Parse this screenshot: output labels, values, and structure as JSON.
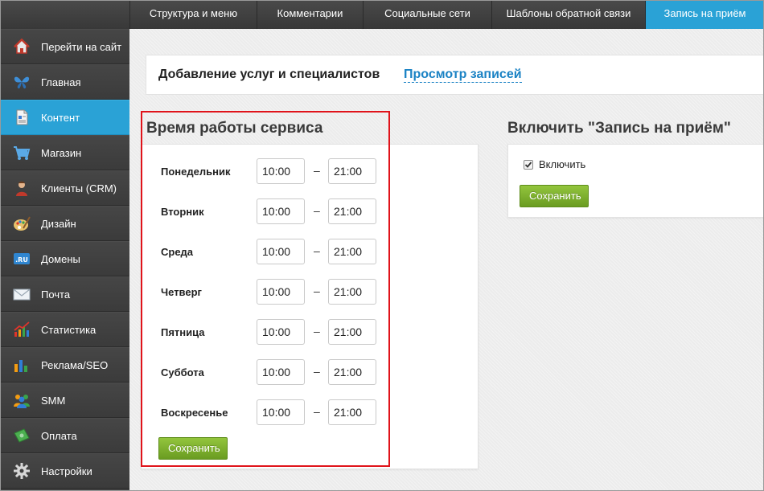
{
  "topbar": {
    "tabs": [
      {
        "label": "Структура и меню",
        "active": false
      },
      {
        "label": "Комментарии",
        "active": false
      },
      {
        "label": "Социальные сети",
        "active": false
      },
      {
        "label": "Шаблоны обратной связи",
        "active": false
      },
      {
        "label": "Запись на приём",
        "active": true
      }
    ]
  },
  "sidebar": {
    "items": [
      {
        "label": "Перейти на сайт",
        "icon": "home-icon"
      },
      {
        "label": "Главная",
        "icon": "butterfly-icon"
      },
      {
        "label": "Контент",
        "icon": "document-icon",
        "active": true
      },
      {
        "label": "Магазин",
        "icon": "cart-icon"
      },
      {
        "label": "Клиенты (CRM)",
        "icon": "user-icon"
      },
      {
        "label": "Дизайн",
        "icon": "palette-icon"
      },
      {
        "label": "Домены",
        "icon": "domain-ru-icon",
        "badge": ".RU"
      },
      {
        "label": "Почта",
        "icon": "mail-icon"
      },
      {
        "label": "Статистика",
        "icon": "chart-up-icon"
      },
      {
        "label": "Реклама/SEO",
        "icon": "bar-chart-icon"
      },
      {
        "label": "SMM",
        "icon": "people-icon"
      },
      {
        "label": "Оплата",
        "icon": "money-icon"
      },
      {
        "label": "Настройки",
        "icon": "gear-icon"
      }
    ]
  },
  "header": {
    "title": "Добавление услуг и специалистов",
    "link": "Просмотр записей"
  },
  "schedule": {
    "title": "Время работы сервиса",
    "separator": "–",
    "days": [
      {
        "day": "Понедельник",
        "from": "10:00",
        "to": "21:00"
      },
      {
        "day": "Вторник",
        "from": "10:00",
        "to": "21:00"
      },
      {
        "day": "Среда",
        "from": "10:00",
        "to": "21:00"
      },
      {
        "day": "Четверг",
        "from": "10:00",
        "to": "21:00"
      },
      {
        "day": "Пятница",
        "from": "10:00",
        "to": "21:00"
      },
      {
        "day": "Суббота",
        "from": "10:00",
        "to": "21:00"
      },
      {
        "day": "Воскресенье",
        "from": "10:00",
        "to": "21:00"
      }
    ],
    "save_label": "Сохранить"
  },
  "enable": {
    "title": "Включить \"Запись на приём\"",
    "checkbox_label": "Включить",
    "checked": true,
    "save_label": "Сохранить"
  },
  "colors": {
    "accent": "#2aa2d6",
    "sidebar_bg": "#3d3d3d",
    "save_button": "#7cb02f",
    "link": "#1a82c4",
    "highlight_outline": "#e0131a"
  }
}
